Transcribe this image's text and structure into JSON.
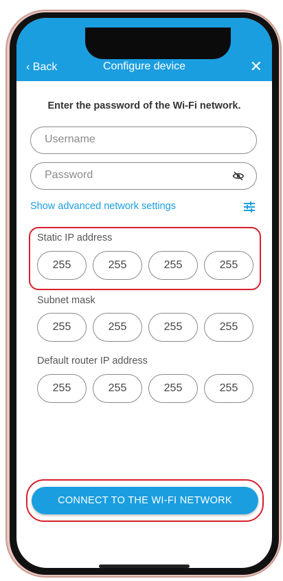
{
  "header": {
    "back_label": "‹ Back",
    "title": "Configure device",
    "close_glyph": "✕"
  },
  "heading": "Enter the password of the Wi-Fi network.",
  "fields": {
    "username_placeholder": "Username",
    "password_placeholder": "Password"
  },
  "advanced_link": "Show advanced network settings",
  "sections": [
    {
      "label": "Static IP address",
      "octets": [
        "255",
        "255",
        "255",
        "255"
      ]
    },
    {
      "label": "Subnet mask",
      "octets": [
        "255",
        "255",
        "255",
        "255"
      ]
    },
    {
      "label": "Default router IP address",
      "octets": [
        "255",
        "255",
        "255",
        "255"
      ]
    }
  ],
  "connect_label": "CONNECT TO THE WI-FI NETWORK",
  "icons": {
    "password_toggle": "eye-off-icon",
    "settings": "sliders-icon"
  },
  "colors": {
    "primary": "#1a9ee0",
    "highlight": "#d81f2c"
  }
}
